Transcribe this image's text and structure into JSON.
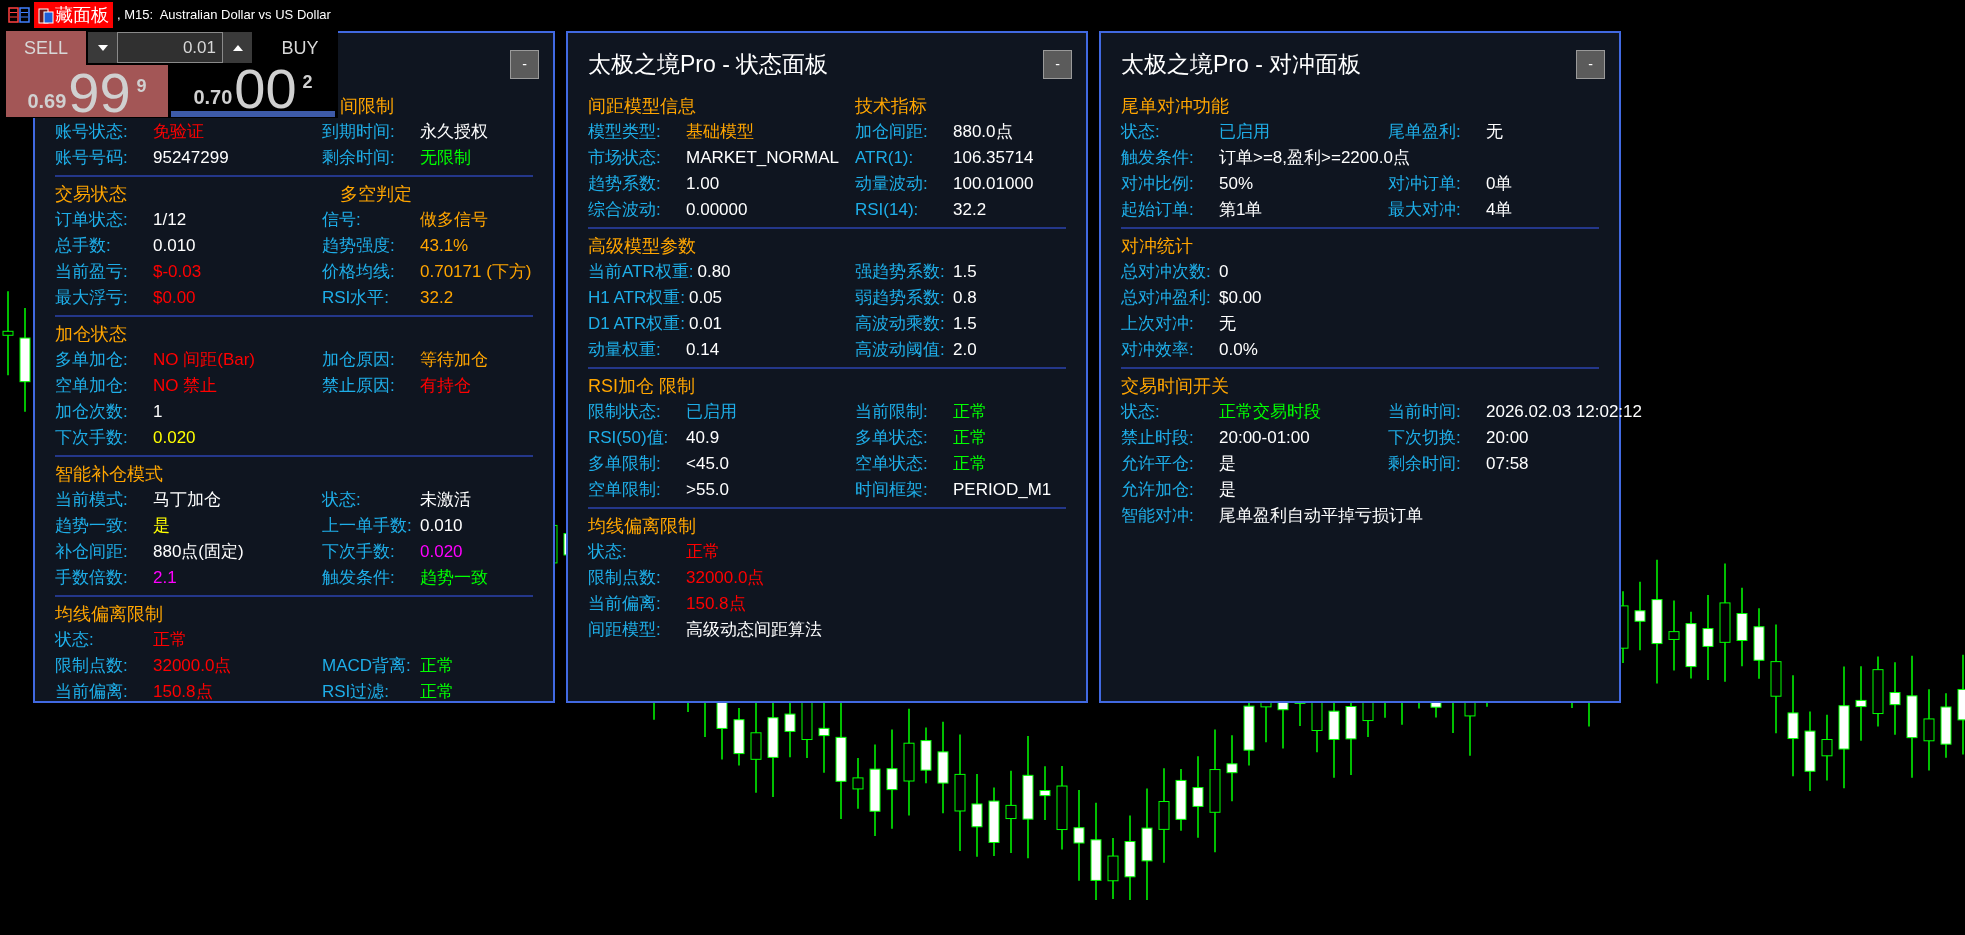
{
  "chart_window": {
    "hide_button": "藏面板",
    "title": ", M15:  Australian Dollar vs US Dollar"
  },
  "trade_panel": {
    "sell_label": "SELL",
    "buy_label": "BUY",
    "volume": "0.01",
    "sell_price": {
      "prefix": "0.69",
      "big": "99",
      "small": "9"
    },
    "buy_price": {
      "prefix": "0.70",
      "big": "00",
      "small": "2"
    }
  },
  "panels": [
    {
      "minimize_button": "-",
      "sections": [
        {
          "heading_2": "间限制",
          "rows": [
            {
              "cells": [
                {
                  "label": "账号状态:",
                  "value": "免验证",
                  "color": "#ff0000"
                },
                {
                  "label": "到期时间:",
                  "value": "永久授权",
                  "color": "#ffffff"
                }
              ]
            },
            {
              "cells": [
                {
                  "label": "账号号码:",
                  "value": "95247299",
                  "color": "#ffffff"
                },
                {
                  "label": "剩余时间:",
                  "value": "无限制",
                  "color": "#00ff00"
                }
              ]
            }
          ]
        },
        {
          "heading": "交易状态",
          "heading_2": "多空判定",
          "rows": [
            {
              "cells": [
                {
                  "label": "订单状态:",
                  "value": "1/12",
                  "color": "#ffffff"
                },
                {
                  "label": "信号:",
                  "value": "做多信号",
                  "color": "#ffa500"
                }
              ]
            },
            {
              "cells": [
                {
                  "label": "总手数:",
                  "value": "0.010",
                  "color": "#ffffff"
                },
                {
                  "label": "趋势强度:",
                  "value": "43.1%",
                  "color": "#ffa500"
                }
              ]
            },
            {
              "cells": [
                {
                  "label": "当前盈亏:",
                  "value": "$-0.03",
                  "color": "#ff0000"
                },
                {
                  "label": "价格均线:",
                  "value": "0.70171 (下方)",
                  "color": "#ffa500"
                }
              ]
            },
            {
              "cells": [
                {
                  "label": "最大浮亏:",
                  "value": "$0.00",
                  "color": "#ff0000"
                },
                {
                  "label": "RSI水平:",
                  "value": "32.2",
                  "color": "#ffa500"
                }
              ]
            }
          ]
        },
        {
          "heading": "加仓状态",
          "rows": [
            {
              "cells": [
                {
                  "label": "多单加仓:",
                  "value": "NO 间距(Bar)",
                  "color": "#ff0000"
                },
                {
                  "label": "加仓原因:",
                  "value": "等待加仓",
                  "color": "#ffa500"
                }
              ]
            },
            {
              "cells": [
                {
                  "label": "空单加仓:",
                  "value": "NO 禁止",
                  "color": "#ff0000"
                },
                {
                  "label": "禁止原因:",
                  "value": "有持仓",
                  "color": "#ff0000"
                }
              ]
            },
            {
              "cells": [
                {
                  "label": "加仓次数:",
                  "value": "1",
                  "color": "#ffffff"
                }
              ]
            },
            {
              "cells": [
                {
                  "label": "下次手数:",
                  "value": "0.020",
                  "color": "#ffff00"
                }
              ]
            }
          ]
        },
        {
          "heading": "智能补仓模式",
          "rows": [
            {
              "cells": [
                {
                  "label": "当前模式:",
                  "value": "马丁加仓",
                  "color": "#ffffff"
                },
                {
                  "label": "状态:",
                  "value": "未激活",
                  "color": "#ffffff"
                }
              ]
            },
            {
              "cells": [
                {
                  "label": "趋势一致:",
                  "value": "是",
                  "color": "#ffff00"
                },
                {
                  "label": "上一单手数:",
                  "value": "0.010",
                  "color": "#ffffff"
                }
              ]
            },
            {
              "cells": [
                {
                  "label": "补仓间距:",
                  "value": "880点(固定)",
                  "color": "#ffffff"
                },
                {
                  "label": "下次手数:",
                  "value": "0.020",
                  "color": "#ff00ff"
                }
              ]
            },
            {
              "cells": [
                {
                  "label": "手数倍数:",
                  "value": "2.1",
                  "color": "#ff00ff"
                },
                {
                  "label": "触发条件:",
                  "value": "趋势一致",
                  "color": "#00ff00"
                }
              ]
            }
          ]
        },
        {
          "heading": "均线偏离限制",
          "rows": [
            {
              "cells": [
                {
                  "label": "状态:",
                  "value": "正常",
                  "color": "#ff0000"
                }
              ]
            },
            {
              "cells": [
                {
                  "label": "限制点数:",
                  "value": "32000.0点",
                  "color": "#ff0000"
                },
                {
                  "label": "MACD背离:",
                  "value": "正常",
                  "color": "#00ff00"
                }
              ]
            },
            {
              "cells": [
                {
                  "label": "当前偏离:",
                  "value": "150.8点",
                  "color": "#ff0000"
                },
                {
                  "label": "RSI过滤:",
                  "value": "正常",
                  "color": "#00ff00"
                }
              ]
            }
          ]
        }
      ]
    },
    {
      "title": "太极之境Pro - 状态面板",
      "minimize_button": "-",
      "sections": [
        {
          "heading": "间距模型信息",
          "heading_2": "技术指标",
          "rows": [
            {
              "cells": [
                {
                  "label": "模型类型:",
                  "value": "基础模型",
                  "color": "#ffa500"
                },
                {
                  "label": "加仓间距:",
                  "value": "880.0点",
                  "color": "#ffffff"
                }
              ]
            },
            {
              "cells": [
                {
                  "label": "市场状态:",
                  "value": "MARKET_NORMAL",
                  "color": "#ffffff"
                },
                {
                  "label": "ATR(1):",
                  "value": "106.35714",
                  "color": "#ffffff"
                }
              ]
            },
            {
              "cells": [
                {
                  "label": "趋势系数:",
                  "value": "1.00",
                  "color": "#ffffff"
                },
                {
                  "label": "动量波动:",
                  "value": "100.01000",
                  "color": "#ffffff"
                }
              ]
            },
            {
              "cells": [
                {
                  "label": "综合波动:",
                  "value": "0.00000",
                  "color": "#ffffff"
                },
                {
                  "label": "RSI(14):",
                  "value": "32.2",
                  "color": "#ffffff"
                }
              ]
            }
          ]
        },
        {
          "heading": "高级模型参数",
          "rows": [
            {
              "cells": [
                {
                  "label": "当前ATR权重:",
                  "value": "0.80",
                  "color": "#ffffff"
                },
                {
                  "label": "强趋势系数:",
                  "value": "1.5",
                  "color": "#ffffff"
                }
              ]
            },
            {
              "cells": [
                {
                  "label": "H1 ATR权重:",
                  "value": "0.05",
                  "color": "#ffffff"
                },
                {
                  "label": "弱趋势系数:",
                  "value": "0.8",
                  "color": "#ffffff"
                }
              ]
            },
            {
              "cells": [
                {
                  "label": "D1 ATR权重:",
                  "value": "0.01",
                  "color": "#ffffff"
                },
                {
                  "label": "高波动乘数:",
                  "value": "1.5",
                  "color": "#ffffff"
                }
              ]
            },
            {
              "cells": [
                {
                  "label": "动量权重:",
                  "value": "0.14",
                  "color": "#ffffff"
                },
                {
                  "label": "高波动阈值:",
                  "value": "2.0",
                  "color": "#ffffff"
                }
              ]
            }
          ]
        },
        {
          "heading": "RSI加仓 限制",
          "rows": [
            {
              "cells": [
                {
                  "label": "限制状态:",
                  "value": "已启用",
                  "color": "#1eaee8"
                },
                {
                  "label": "当前限制:",
                  "value": "正常",
                  "color": "#00ff00"
                }
              ]
            },
            {
              "cells": [
                {
                  "label": "RSI(50)值:",
                  "value": "40.9",
                  "color": "#ffffff"
                },
                {
                  "label": "多单状态:",
                  "value": "正常",
                  "color": "#00ff00"
                }
              ]
            },
            {
              "cells": [
                {
                  "label": "多单限制:",
                  "value": "<45.0",
                  "color": "#ffffff"
                },
                {
                  "label": "空单状态:",
                  "value": "正常",
                  "color": "#00ff00"
                }
              ]
            },
            {
              "cells": [
                {
                  "label": "空单限制:",
                  "value": ">55.0",
                  "color": "#ffffff"
                },
                {
                  "label": "时间框架:",
                  "value": "PERIOD_M1",
                  "color": "#ffffff"
                }
              ]
            }
          ]
        },
        {
          "heading": "均线偏离限制",
          "rows": [
            {
              "cells": [
                {
                  "label": "状态:",
                  "value": "正常",
                  "color": "#ff0000"
                }
              ]
            },
            {
              "cells": [
                {
                  "label": "限制点数:",
                  "value": "32000.0点",
                  "color": "#ff0000"
                }
              ]
            },
            {
              "cells": [
                {
                  "label": "当前偏离:",
                  "value": "150.8点",
                  "color": "#ff0000"
                }
              ]
            },
            {
              "cells": [
                {
                  "label": "间距模型:",
                  "value": "高级动态间距算法",
                  "color": "#ffffff"
                }
              ]
            }
          ]
        }
      ]
    },
    {
      "title": "太极之境Pro - 对冲面板",
      "minimize_button": "-",
      "sections": [
        {
          "heading": "尾单对冲功能",
          "rows": [
            {
              "cells": [
                {
                  "label": "状态:",
                  "value": "已启用",
                  "color": "#1eaee8"
                },
                {
                  "label": "尾单盈利:",
                  "value": "无",
                  "color": "#ffffff"
                }
              ]
            },
            {
              "cells": [
                {
                  "label": "触发条件:",
                  "value": "订单>=8,盈利>=2200.0点",
                  "color": "#ffffff"
                }
              ]
            },
            {
              "cells": [
                {
                  "label": "对冲比例:",
                  "value": "50%",
                  "color": "#ffffff"
                },
                {
                  "label": "对冲订单:",
                  "value": "0单",
                  "color": "#ffffff"
                }
              ]
            },
            {
              "cells": [
                {
                  "label": "起始订单:",
                  "value": "第1单",
                  "color": "#ffffff"
                },
                {
                  "label": "最大对冲:",
                  "value": "4单",
                  "color": "#ffffff"
                }
              ]
            }
          ]
        },
        {
          "heading": "对冲统计",
          "rows": [
            {
              "cells": [
                {
                  "label": "总对冲次数:",
                  "value": "0",
                  "color": "#ffffff"
                }
              ]
            },
            {
              "cells": [
                {
                  "label": "总对冲盈利:",
                  "value": "$0.00",
                  "color": "#ffffff"
                }
              ]
            },
            {
              "cells": [
                {
                  "label": "上次对冲:",
                  "value": "无",
                  "color": "#ffffff"
                }
              ]
            },
            {
              "cells": [
                {
                  "label": "对冲效率:",
                  "value": "0.0%",
                  "color": "#ffffff"
                }
              ]
            }
          ]
        },
        {
          "heading": "交易时间开关",
          "rows": [
            {
              "cells": [
                {
                  "label": "状态:",
                  "value": "正常交易时段",
                  "color": "#00ff00"
                },
                {
                  "label": "当前时间:",
                  "value": "2026.02.03 12:02:12",
                  "color": "#ffffff"
                }
              ]
            },
            {
              "cells": [
                {
                  "label": "禁止时段:",
                  "value": "20:00-01:00",
                  "color": "#ffffff"
                },
                {
                  "label": "下次切换:",
                  "value": "20:00",
                  "color": "#ffffff"
                }
              ]
            },
            {
              "cells": [
                {
                  "label": "允许平仓:",
                  "value": "是",
                  "color": "#ffffff"
                },
                {
                  "label": "剩余时间:",
                  "value": "07:58",
                  "color": "#ffffff"
                }
              ]
            },
            {
              "cells": [
                {
                  "label": "允许加仓:",
                  "value": "是",
                  "color": "#ffffff"
                }
              ]
            },
            {
              "cells": [
                {
                  "label": "智能对冲:",
                  "value": "尾单盈利自动平掉亏损订单",
                  "color": "#ffffff"
                }
              ]
            }
          ]
        }
      ]
    }
  ]
}
